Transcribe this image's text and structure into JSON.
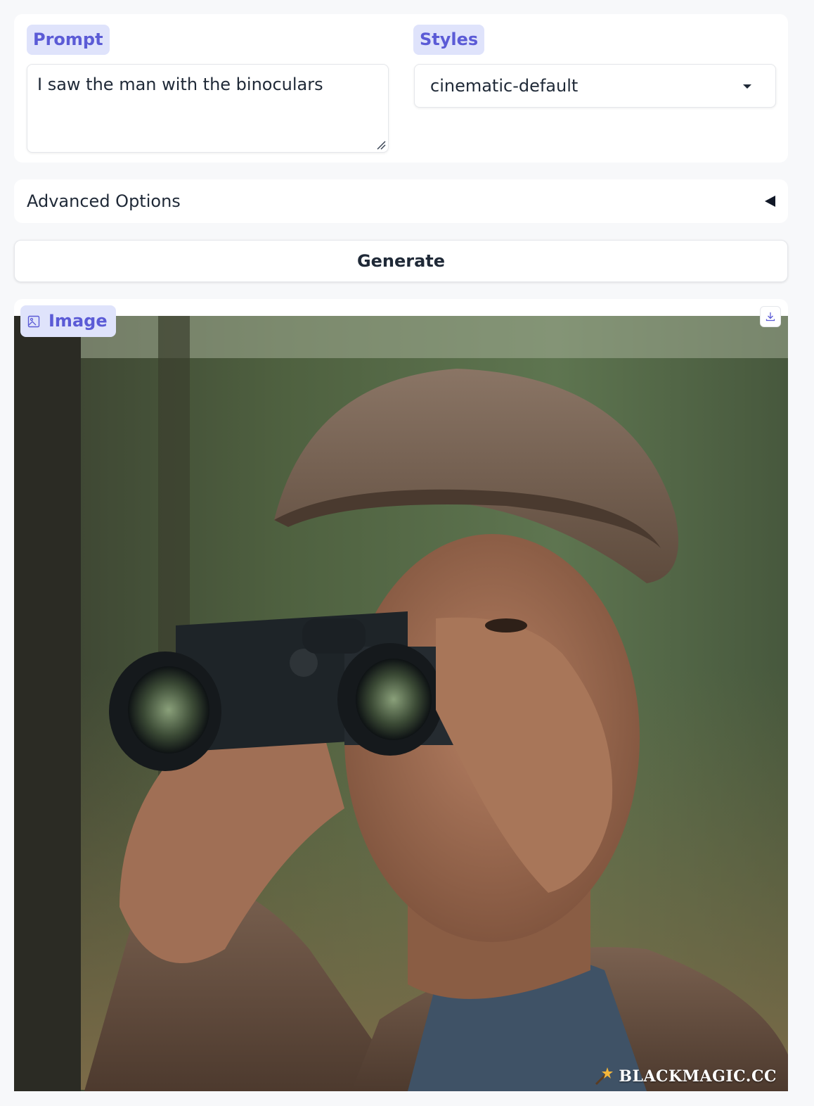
{
  "prompt": {
    "label": "Prompt",
    "value": "I saw the man with the binoculars"
  },
  "styles": {
    "label": "Styles",
    "selected": "cinematic-default"
  },
  "advanced": {
    "label": "Advanced Options"
  },
  "generate": {
    "label": "Generate"
  },
  "output": {
    "label": "Image",
    "watermark": "BLACKMAGIC.CC"
  },
  "colors": {
    "accent": "#5b5bd6",
    "chip_bg": "#dfe3fb",
    "page_bg": "#f7f8fa"
  }
}
